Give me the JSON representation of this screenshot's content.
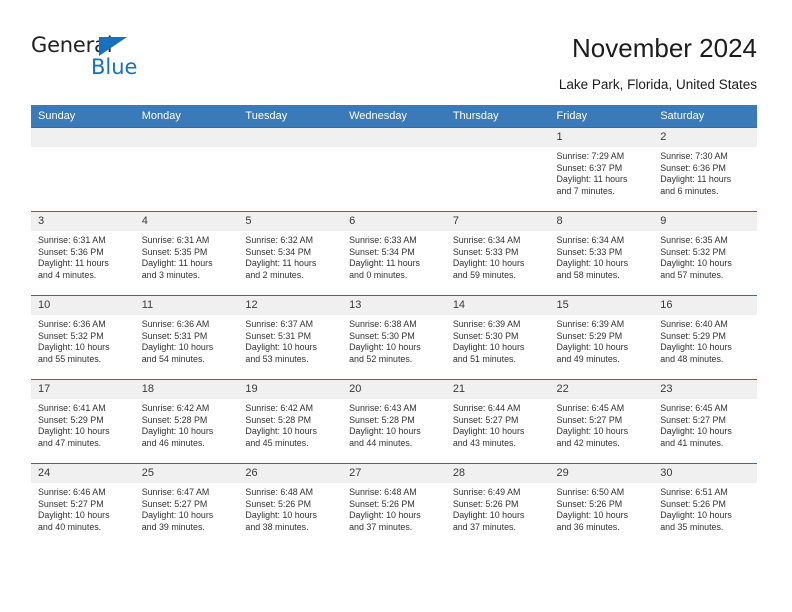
{
  "logo": {
    "word_one": "General",
    "word_two": "Blue",
    "mark": "blue-triangle",
    "accent_color": "#1572c0"
  },
  "header": {
    "title": "November 2024",
    "location": "Lake Park, Florida, United States"
  },
  "theme": {
    "header_blue": "#3a7ab8",
    "row_rule": "#2e6da8",
    "day_band": "#f0f0f0"
  },
  "calendar": {
    "weekday_headers": [
      "Sunday",
      "Monday",
      "Tuesday",
      "Wednesday",
      "Thursday",
      "Friday",
      "Saturday"
    ],
    "weeks": [
      [
        {
          "day": "",
          "sunrise": "",
          "sunset": "",
          "daylight_line1": "",
          "daylight_line2": ""
        },
        {
          "day": "",
          "sunrise": "",
          "sunset": "",
          "daylight_line1": "",
          "daylight_line2": ""
        },
        {
          "day": "",
          "sunrise": "",
          "sunset": "",
          "daylight_line1": "",
          "daylight_line2": ""
        },
        {
          "day": "",
          "sunrise": "",
          "sunset": "",
          "daylight_line1": "",
          "daylight_line2": ""
        },
        {
          "day": "",
          "sunrise": "",
          "sunset": "",
          "daylight_line1": "",
          "daylight_line2": ""
        },
        {
          "day": "1",
          "sunrise": "Sunrise: 7:29 AM",
          "sunset": "Sunset: 6:37 PM",
          "daylight_line1": "Daylight: 11 hours",
          "daylight_line2": "and 7 minutes."
        },
        {
          "day": "2",
          "sunrise": "Sunrise: 7:30 AM",
          "sunset": "Sunset: 6:36 PM",
          "daylight_line1": "Daylight: 11 hours",
          "daylight_line2": "and 6 minutes."
        }
      ],
      [
        {
          "day": "3",
          "sunrise": "Sunrise: 6:31 AM",
          "sunset": "Sunset: 5:36 PM",
          "daylight_line1": "Daylight: 11 hours",
          "daylight_line2": "and 4 minutes."
        },
        {
          "day": "4",
          "sunrise": "Sunrise: 6:31 AM",
          "sunset": "Sunset: 5:35 PM",
          "daylight_line1": "Daylight: 11 hours",
          "daylight_line2": "and 3 minutes."
        },
        {
          "day": "5",
          "sunrise": "Sunrise: 6:32 AM",
          "sunset": "Sunset: 5:34 PM",
          "daylight_line1": "Daylight: 11 hours",
          "daylight_line2": "and 2 minutes."
        },
        {
          "day": "6",
          "sunrise": "Sunrise: 6:33 AM",
          "sunset": "Sunset: 5:34 PM",
          "daylight_line1": "Daylight: 11 hours",
          "daylight_line2": "and 0 minutes."
        },
        {
          "day": "7",
          "sunrise": "Sunrise: 6:34 AM",
          "sunset": "Sunset: 5:33 PM",
          "daylight_line1": "Daylight: 10 hours",
          "daylight_line2": "and 59 minutes."
        },
        {
          "day": "8",
          "sunrise": "Sunrise: 6:34 AM",
          "sunset": "Sunset: 5:33 PM",
          "daylight_line1": "Daylight: 10 hours",
          "daylight_line2": "and 58 minutes."
        },
        {
          "day": "9",
          "sunrise": "Sunrise: 6:35 AM",
          "sunset": "Sunset: 5:32 PM",
          "daylight_line1": "Daylight: 10 hours",
          "daylight_line2": "and 57 minutes."
        }
      ],
      [
        {
          "day": "10",
          "sunrise": "Sunrise: 6:36 AM",
          "sunset": "Sunset: 5:32 PM",
          "daylight_line1": "Daylight: 10 hours",
          "daylight_line2": "and 55 minutes."
        },
        {
          "day": "11",
          "sunrise": "Sunrise: 6:36 AM",
          "sunset": "Sunset: 5:31 PM",
          "daylight_line1": "Daylight: 10 hours",
          "daylight_line2": "and 54 minutes."
        },
        {
          "day": "12",
          "sunrise": "Sunrise: 6:37 AM",
          "sunset": "Sunset: 5:31 PM",
          "daylight_line1": "Daylight: 10 hours",
          "daylight_line2": "and 53 minutes."
        },
        {
          "day": "13",
          "sunrise": "Sunrise: 6:38 AM",
          "sunset": "Sunset: 5:30 PM",
          "daylight_line1": "Daylight: 10 hours",
          "daylight_line2": "and 52 minutes."
        },
        {
          "day": "14",
          "sunrise": "Sunrise: 6:39 AM",
          "sunset": "Sunset: 5:30 PM",
          "daylight_line1": "Daylight: 10 hours",
          "daylight_line2": "and 51 minutes."
        },
        {
          "day": "15",
          "sunrise": "Sunrise: 6:39 AM",
          "sunset": "Sunset: 5:29 PM",
          "daylight_line1": "Daylight: 10 hours",
          "daylight_line2": "and 49 minutes."
        },
        {
          "day": "16",
          "sunrise": "Sunrise: 6:40 AM",
          "sunset": "Sunset: 5:29 PM",
          "daylight_line1": "Daylight: 10 hours",
          "daylight_line2": "and 48 minutes."
        }
      ],
      [
        {
          "day": "17",
          "sunrise": "Sunrise: 6:41 AM",
          "sunset": "Sunset: 5:29 PM",
          "daylight_line1": "Daylight: 10 hours",
          "daylight_line2": "and 47 minutes."
        },
        {
          "day": "18",
          "sunrise": "Sunrise: 6:42 AM",
          "sunset": "Sunset: 5:28 PM",
          "daylight_line1": "Daylight: 10 hours",
          "daylight_line2": "and 46 minutes."
        },
        {
          "day": "19",
          "sunrise": "Sunrise: 6:42 AM",
          "sunset": "Sunset: 5:28 PM",
          "daylight_line1": "Daylight: 10 hours",
          "daylight_line2": "and 45 minutes."
        },
        {
          "day": "20",
          "sunrise": "Sunrise: 6:43 AM",
          "sunset": "Sunset: 5:28 PM",
          "daylight_line1": "Daylight: 10 hours",
          "daylight_line2": "and 44 minutes."
        },
        {
          "day": "21",
          "sunrise": "Sunrise: 6:44 AM",
          "sunset": "Sunset: 5:27 PM",
          "daylight_line1": "Daylight: 10 hours",
          "daylight_line2": "and 43 minutes."
        },
        {
          "day": "22",
          "sunrise": "Sunrise: 6:45 AM",
          "sunset": "Sunset: 5:27 PM",
          "daylight_line1": "Daylight: 10 hours",
          "daylight_line2": "and 42 minutes."
        },
        {
          "day": "23",
          "sunrise": "Sunrise: 6:45 AM",
          "sunset": "Sunset: 5:27 PM",
          "daylight_line1": "Daylight: 10 hours",
          "daylight_line2": "and 41 minutes."
        }
      ],
      [
        {
          "day": "24",
          "sunrise": "Sunrise: 6:46 AM",
          "sunset": "Sunset: 5:27 PM",
          "daylight_line1": "Daylight: 10 hours",
          "daylight_line2": "and 40 minutes."
        },
        {
          "day": "25",
          "sunrise": "Sunrise: 6:47 AM",
          "sunset": "Sunset: 5:27 PM",
          "daylight_line1": "Daylight: 10 hours",
          "daylight_line2": "and 39 minutes."
        },
        {
          "day": "26",
          "sunrise": "Sunrise: 6:48 AM",
          "sunset": "Sunset: 5:26 PM",
          "daylight_line1": "Daylight: 10 hours",
          "daylight_line2": "and 38 minutes."
        },
        {
          "day": "27",
          "sunrise": "Sunrise: 6:48 AM",
          "sunset": "Sunset: 5:26 PM",
          "daylight_line1": "Daylight: 10 hours",
          "daylight_line2": "and 37 minutes."
        },
        {
          "day": "28",
          "sunrise": "Sunrise: 6:49 AM",
          "sunset": "Sunset: 5:26 PM",
          "daylight_line1": "Daylight: 10 hours",
          "daylight_line2": "and 37 minutes."
        },
        {
          "day": "29",
          "sunrise": "Sunrise: 6:50 AM",
          "sunset": "Sunset: 5:26 PM",
          "daylight_line1": "Daylight: 10 hours",
          "daylight_line2": "and 36 minutes."
        },
        {
          "day": "30",
          "sunrise": "Sunrise: 6:51 AM",
          "sunset": "Sunset: 5:26 PM",
          "daylight_line1": "Daylight: 10 hours",
          "daylight_line2": "and 35 minutes."
        }
      ]
    ]
  }
}
